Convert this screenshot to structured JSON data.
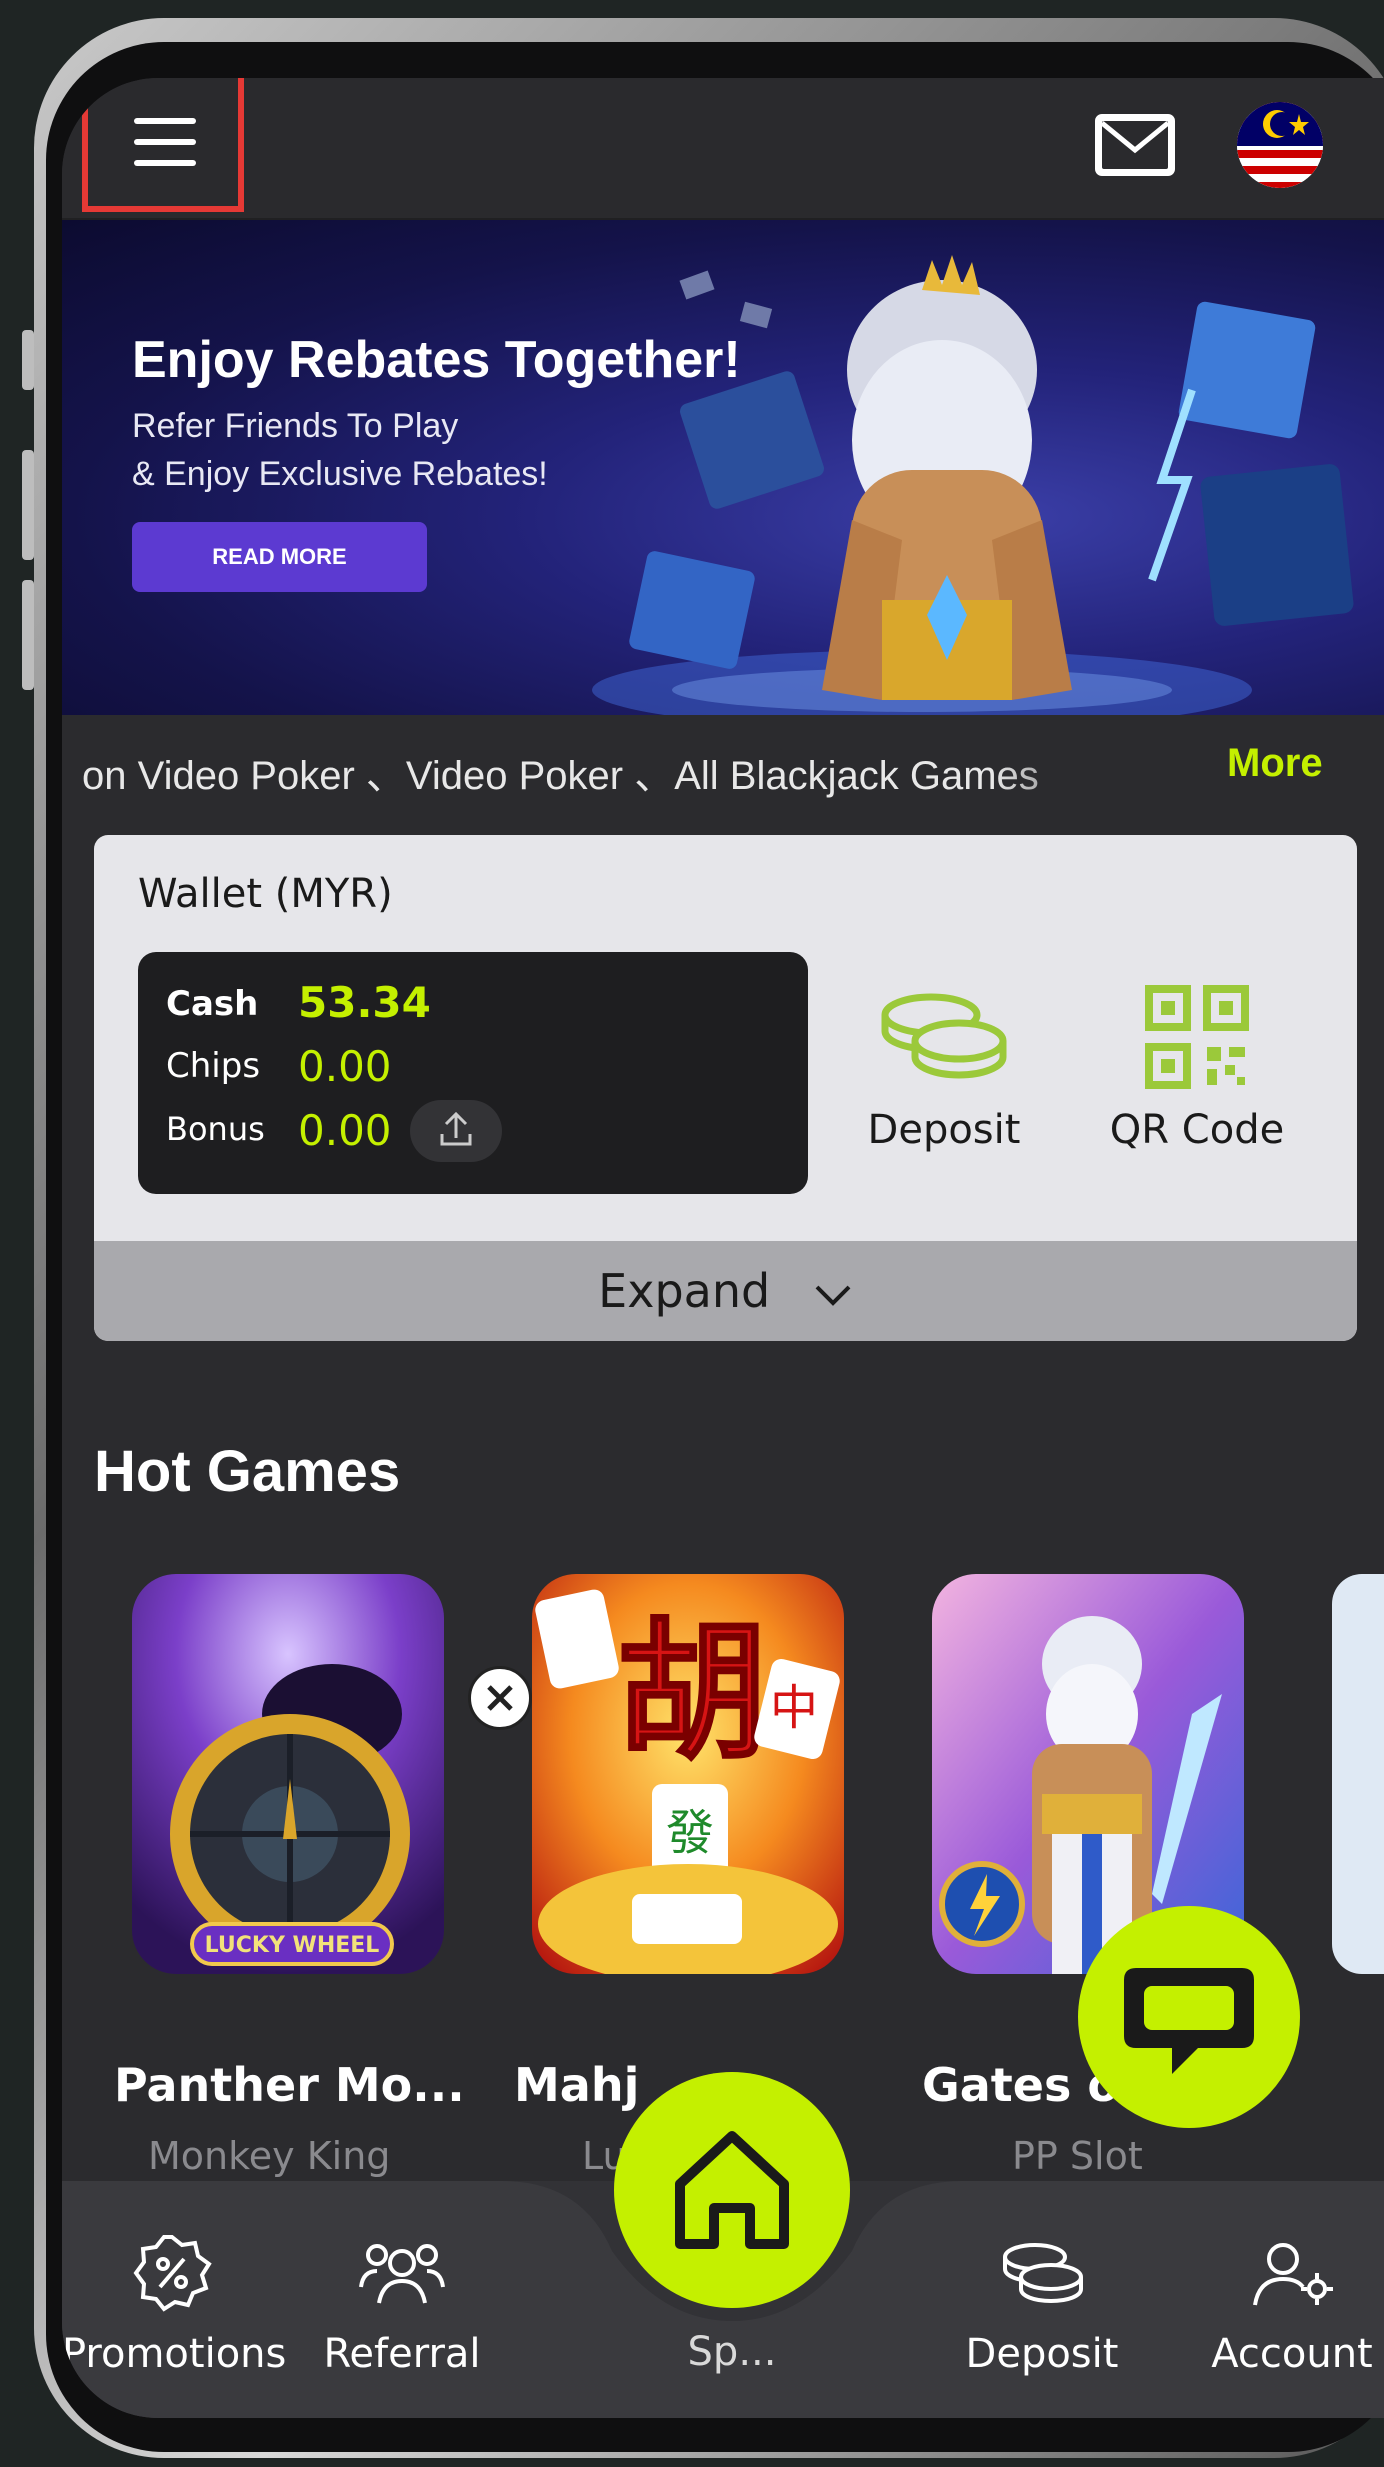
{
  "topbar": {
    "menu_icon": "hamburger-menu-icon",
    "mail_icon": "mail-icon",
    "flag_icon": "malaysia-flag-icon"
  },
  "banner": {
    "title": "Enjoy Rebates Together!",
    "subtitle_line1": "Refer Friends To Play",
    "subtitle_line2": "& Enjoy Exclusive Rebates!",
    "button_label": "READ MORE"
  },
  "ticker": {
    "text": "on Video Poker 、Video Poker 、All Blackjack Games",
    "more_label": "More"
  },
  "wallet": {
    "title": "Wallet (MYR)",
    "cash_label": "Cash",
    "cash_value": "53.34",
    "chips_label": "Chips",
    "chips_value": "0.00",
    "bonus_label": "Bonus",
    "bonus_value": "0.00",
    "deposit_label": "Deposit",
    "qr_label": "QR Code",
    "expand_label": "Expand"
  },
  "hot_games": {
    "title": "Hot Games",
    "games": [
      {
        "name": "Panther Mo...",
        "provider": "Monkey King"
      },
      {
        "name": "Mahj",
        "provider": "Lu"
      },
      {
        "name": "Gates of ...",
        "provider": "PP Slot"
      }
    ]
  },
  "bottom_nav": {
    "items": [
      {
        "label": "Promotions",
        "icon": "percent-badge-icon"
      },
      {
        "label": "Referral",
        "icon": "users-icon"
      },
      {
        "label": "Sp...",
        "icon": "home-icon"
      },
      {
        "label": "Deposit",
        "icon": "coins-icon"
      },
      {
        "label": "Account",
        "icon": "user-settings-icon"
      }
    ]
  },
  "colors": {
    "accent": "#c4f000",
    "background": "#2b2b2e",
    "highlight_box": "#e53935"
  }
}
